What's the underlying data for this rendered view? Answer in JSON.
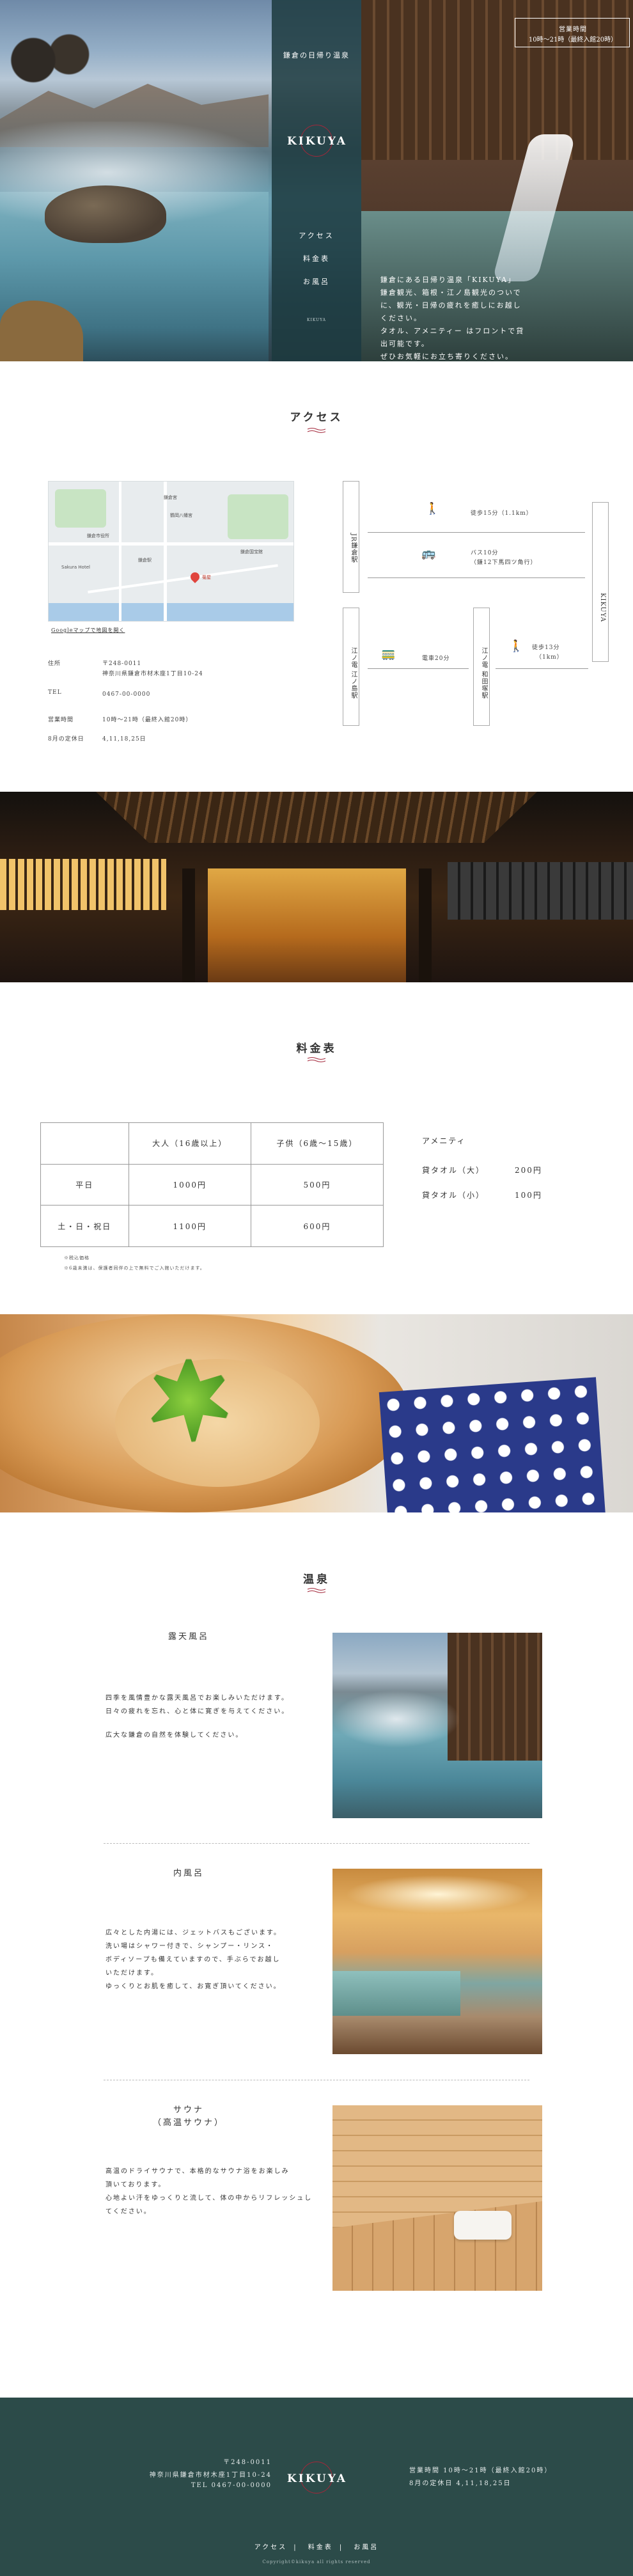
{
  "hero": {
    "subtitle": "鎌倉の日帰り温泉",
    "logo": "KIKUYA",
    "nav": [
      "アクセス",
      "料金表",
      "お風呂"
    ],
    "copyright": "KIKUYA",
    "hours_tag": "営業時間",
    "hours_line1": "営業時間",
    "hours_line2": "10時〜21時（最終入館20時）",
    "intro": [
      "鎌倉にある日帰り温泉「KIKUYA」",
      "鎌倉観光、箱根・江ノ島観光のついでに、観光・日帰の疲れを癒しにお越しください。",
      "タオル、アメニティー はフロントで貸出可能です。",
      "ぜひお気軽にお立ち寄りください。"
    ]
  },
  "access": {
    "title": "アクセス",
    "map_link": "Googleマップで地図を開く",
    "map_labels": [
      "鎌倉宮",
      "鎌倉市役所",
      "鶴岡八幡宮",
      "鎌倉国宝館",
      "Sakura Hotel",
      "鎌倉駅",
      "菊屋"
    ],
    "address_label": "住所",
    "address_zip": "〒248-0011",
    "address": "神奈川県鎌倉市材木座1丁目10-24",
    "tel_label": "TEL",
    "tel": "0467-00-0000",
    "hours_label": "営業時間",
    "hours": "10時〜21時（最終入館20時）",
    "holiday_label": "8月の定休日",
    "holiday": "4,11,18,25日",
    "jr": "JR鎌倉駅",
    "enoden": "江ノ電 江ノ島駅",
    "enoden2": "江ノ電 和田塚駅",
    "kikuya": "KIKUYA",
    "walk1": "徒歩15分（1.1km）",
    "bus": "バス10分",
    "bus2": "（鎌12下馬四ツ角行）",
    "train": "電車20分",
    "walk2": "徒歩13分",
    "walk2b": "（1km）"
  },
  "price": {
    "title": "料金表",
    "header": [
      "",
      "大人（16歳以上）",
      "子供（6歳〜15歳）"
    ],
    "rows": [
      [
        "平日",
        "1000円",
        "500円"
      ],
      [
        "土・日・祝日",
        "1100円",
        "600円"
      ]
    ],
    "note1": "※税込価格",
    "note2": "※6歳未満は、保護者同伴の上で無料でご入館いただけます。",
    "amenity_title": "アメニティ",
    "amenities": [
      {
        "name": "貸タオル（大）",
        "price": "200円"
      },
      {
        "name": "貸タオル（小）",
        "price": "100円"
      }
    ]
  },
  "onsen": {
    "title": "温泉",
    "items": [
      {
        "title": "露天風呂",
        "text": [
          "四季を風情豊かな露天風呂でお楽しみいただけます。",
          "日々の疲れを忘れ、心と体に寛ぎを与えてください。",
          "広大な鎌倉の自然を体験してください。"
        ]
      },
      {
        "title": "内風呂",
        "text": [
          "広々とした内湯には、ジェットバスもございます。",
          "洗い場はシャワー付きで、シャンプー・リンス・",
          "ボディソープも備えていますので、手ぶらでお越し",
          "いただけます。",
          "ゆっくりとお肌を癒して、お寛ぎ頂いてください。"
        ]
      },
      {
        "title": "サウナ",
        "title2": "（高温サウナ）",
        "text": [
          "高温のドライサウナで、本格的なサウナ浴をお楽しみ",
          "頂いております。",
          "心地よい汗をゆっくりと流して、体の中からリフレッシュしてください。"
        ]
      }
    ]
  },
  "footer": {
    "zip": "〒248-0011",
    "address": "神奈川県鎌倉市材木座1丁目10-24",
    "tel": "TEL 0467-00-0000",
    "logo": "KIKUYA",
    "hours": "営業時間 10時〜21時（最終入館20時）",
    "holiday": "8月の定休日 4,11,18,25日",
    "nav": [
      "アクセス",
      "料金表",
      "お風呂"
    ],
    "copyright": "Copyright©kikuya all rights reserved"
  },
  "colors": {
    "accent": "#a3273a",
    "panel": "#1c3a3e",
    "footer": "#2c4b49"
  }
}
